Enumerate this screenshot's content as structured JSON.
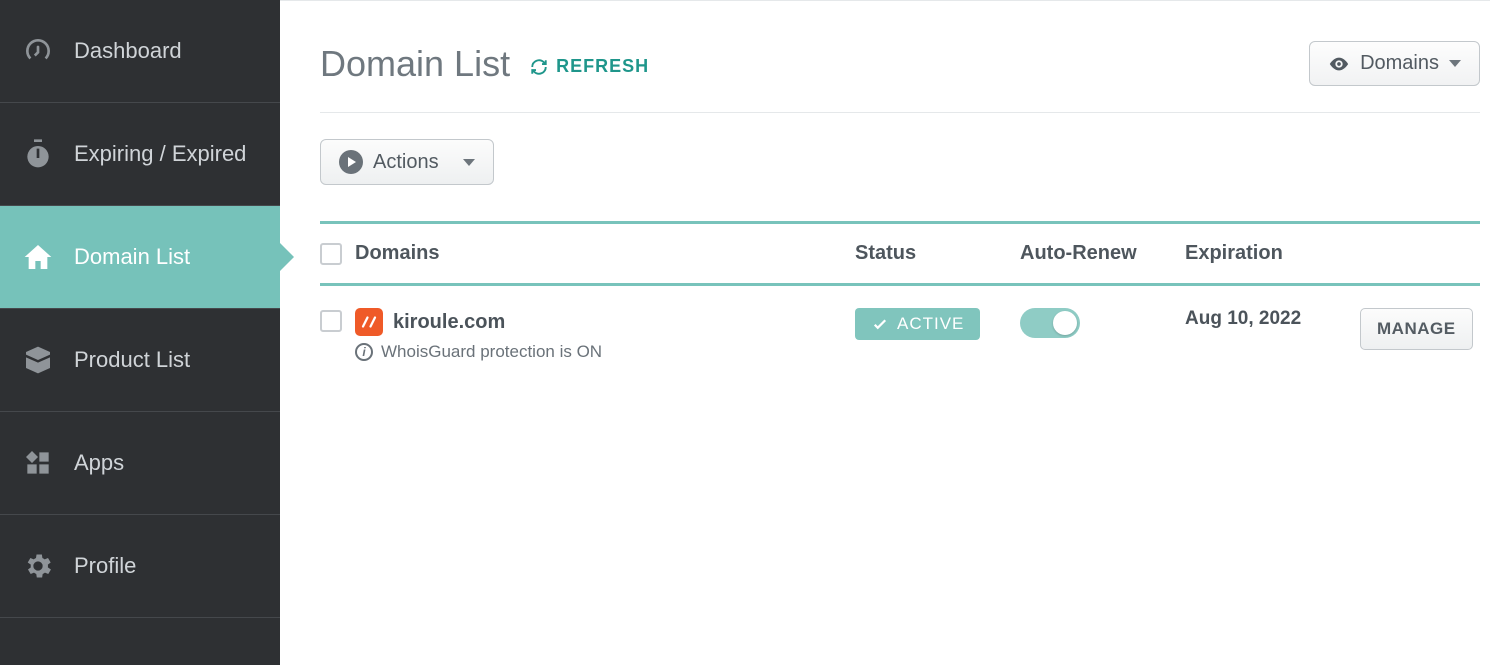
{
  "sidebar": {
    "items": [
      {
        "label": "Dashboard"
      },
      {
        "label": "Expiring / Expired"
      },
      {
        "label": "Domain List"
      },
      {
        "label": "Product List"
      },
      {
        "label": "Apps"
      },
      {
        "label": "Profile"
      }
    ]
  },
  "header": {
    "title": "Domain List",
    "refresh_label": "REFRESH",
    "view_dropdown_label": "Domains"
  },
  "toolbar": {
    "actions_label": "Actions"
  },
  "table": {
    "columns": {
      "domains": "Domains",
      "status": "Status",
      "auto_renew": "Auto-Renew",
      "expiration": "Expiration"
    },
    "rows": [
      {
        "domain": "kiroule.com",
        "whois_text": "WhoisGuard protection is ON",
        "status_label": "ACTIVE",
        "auto_renew": true,
        "expiration": "Aug 10, 2022",
        "manage_label": "MANAGE"
      }
    ]
  }
}
